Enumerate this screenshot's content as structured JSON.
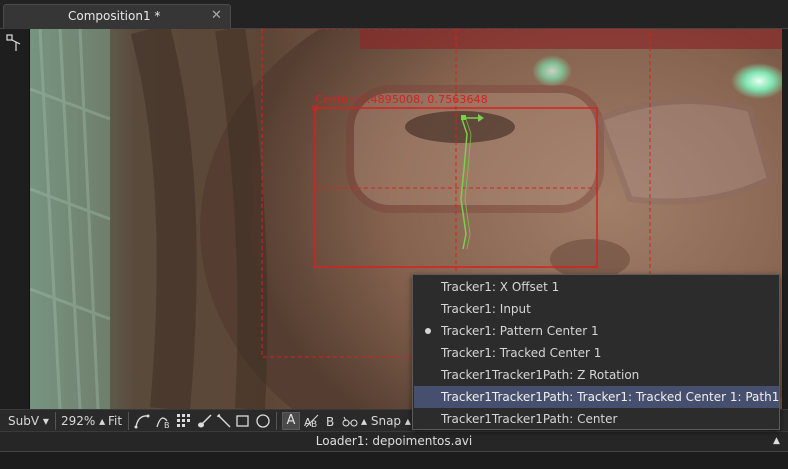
{
  "tab": {
    "title": "Composition1 *",
    "close": "✕"
  },
  "viewer": {
    "center_label": "Center: 0.4895008, 0.7563648"
  },
  "toolbar": {
    "subview": "SubV",
    "zoom": "292%",
    "fit": "Fit",
    "a_label": "A",
    "snap": "Snap"
  },
  "status": {
    "loader": "Loader1: depoimentos.avi"
  },
  "context_menu": {
    "items": [
      {
        "label": "Tracker1: X Offset 1"
      },
      {
        "label": "Tracker1: Input"
      },
      {
        "label": "Tracker1: Pattern Center 1",
        "checked": true
      },
      {
        "label": "Tracker1: Tracked Center 1"
      },
      {
        "label": "Tracker1Tracker1Path: Z Rotation"
      },
      {
        "label": "Tracker1Tracker1Path: Tracker1: Tracked Center 1: Path1",
        "highlighted": true
      },
      {
        "label": "Tracker1Tracker1Path: Center"
      }
    ]
  },
  "colors": {
    "overlay_red": "#d92020",
    "track_green": "#7ad04a",
    "highlight": "#46506e"
  }
}
